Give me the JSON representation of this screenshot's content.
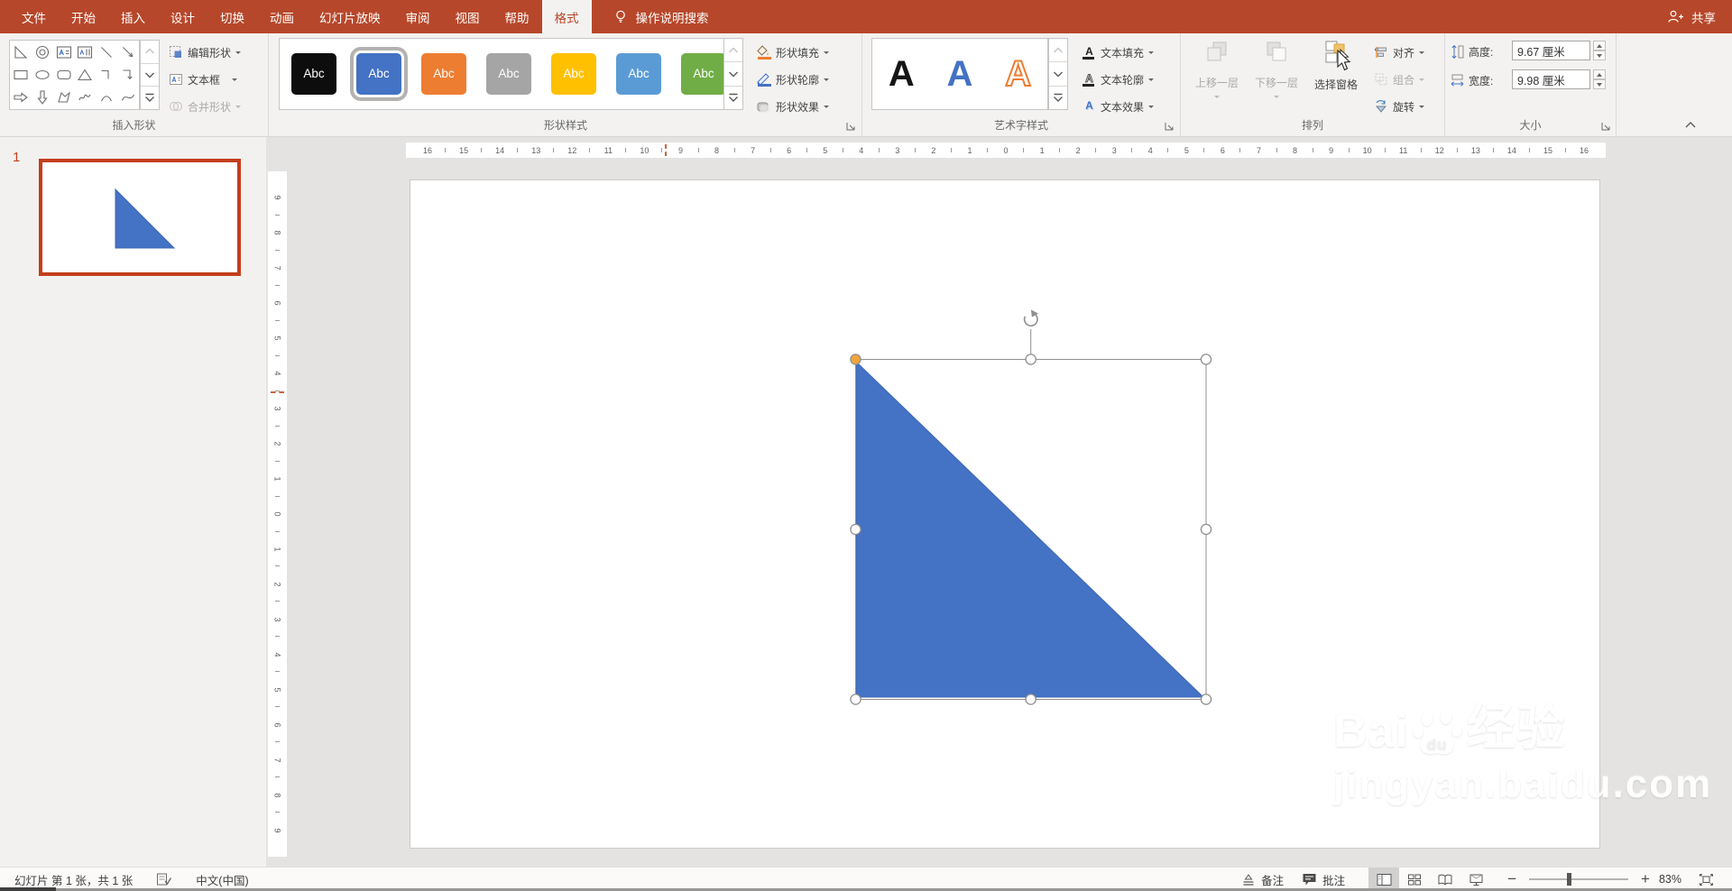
{
  "titlebar": {
    "tabs": [
      {
        "label": "文件"
      },
      {
        "label": "开始"
      },
      {
        "label": "插入"
      },
      {
        "label": "设计"
      },
      {
        "label": "切换"
      },
      {
        "label": "动画"
      },
      {
        "label": "幻灯片放映"
      },
      {
        "label": "审阅"
      },
      {
        "label": "视图"
      },
      {
        "label": "帮助"
      },
      {
        "label": "格式",
        "active": true
      }
    ],
    "search_label": "操作说明搜索",
    "share_label": "共享"
  },
  "ribbon": {
    "insert_shapes": {
      "label": "插入形状",
      "buttons": [
        {
          "label": "编辑形状",
          "disabled": false
        },
        {
          "label": "文本框",
          "disabled": false
        },
        {
          "label": "合并形状",
          "disabled": true
        }
      ]
    },
    "shape_styles": {
      "label": "形状样式",
      "swatches": [
        {
          "label": "Abc",
          "bg": "#0D0D0D",
          "fg": "#FFFFFF",
          "selected": false
        },
        {
          "label": "Abc",
          "bg": "#4472C4",
          "fg": "#FFFFFF",
          "selected": true
        },
        {
          "label": "Abc",
          "bg": "#ED7D31",
          "fg": "#FFFFFF",
          "selected": false
        },
        {
          "label": "Abc",
          "bg": "#A5A5A5",
          "fg": "#FFFFFF",
          "selected": false
        },
        {
          "label": "Abc",
          "bg": "#FFC000",
          "fg": "#FFFFFF",
          "selected": false
        },
        {
          "label": "Abc",
          "bg": "#5B9BD5",
          "fg": "#FFFFFF",
          "selected": false
        },
        {
          "label": "Abc",
          "bg": "#70AD47",
          "fg": "#FFFFFF",
          "selected": false
        }
      ],
      "buttons": [
        {
          "label": "形状填充",
          "bar_color": "#ED7D31"
        },
        {
          "label": "形状轮廓",
          "bar_color": "#4472C4"
        },
        {
          "label": "形状效果",
          "bar_color": ""
        }
      ]
    },
    "wordart": {
      "label": "艺术字样式",
      "samples": [
        "A",
        "A",
        "A"
      ],
      "buttons": [
        {
          "label": "文本填充"
        },
        {
          "label": "文本轮廓"
        },
        {
          "label": "文本效果"
        }
      ]
    },
    "arrange": {
      "label": "排列",
      "big_buttons": [
        {
          "label": "上移一层",
          "disabled": true
        },
        {
          "label": "下移一层",
          "disabled": true
        },
        {
          "label": "选择窗格",
          "disabled": false
        }
      ],
      "menu_buttons": [
        {
          "label": "对齐",
          "disabled": false
        },
        {
          "label": "组合",
          "disabled": true
        },
        {
          "label": "旋转",
          "disabled": false
        }
      ]
    },
    "size": {
      "label": "大小",
      "height_label": "高度:",
      "height_value": "9.67 厘米",
      "width_label": "宽度:",
      "width_value": "9.98 厘米"
    }
  },
  "rulers": {
    "horizontal": [
      16,
      15,
      14,
      13,
      12,
      11,
      10,
      9,
      8,
      7,
      6,
      5,
      4,
      3,
      2,
      1,
      0,
      1,
      2,
      3,
      4,
      5,
      6,
      7,
      8,
      9,
      10,
      11,
      12,
      13,
      14,
      15,
      16
    ],
    "vertical": [
      9,
      8,
      7,
      6,
      5,
      4,
      3,
      2,
      1,
      0,
      1,
      2,
      3,
      4,
      5,
      6,
      7,
      8,
      9
    ]
  },
  "slides_panel": {
    "slide_number": "1"
  },
  "canvas": {
    "shape_fill": "#4472C4",
    "selection_handle_accent": "#F0A53C"
  },
  "watermark": {
    "brand_prefix": "Bai",
    "brand_paw_text": "du",
    "brand_cn": "经验",
    "url": "jingyan.baidu.com"
  },
  "statusbar": {
    "slide_info": "幻灯片 第 1 张，共 1 张",
    "language": "中文(中国)",
    "notes_label": "备注",
    "comments_label": "批注",
    "zoom_level": "83%"
  }
}
